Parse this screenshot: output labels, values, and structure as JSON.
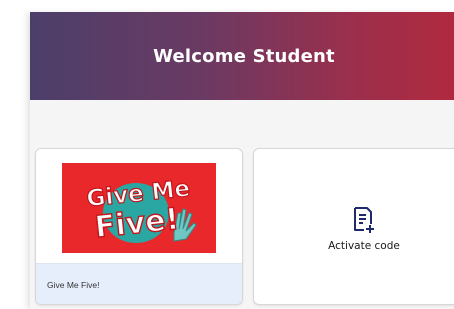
{
  "header": {
    "title": "Welcome Student"
  },
  "books": [
    {
      "title": "Give Me Five!",
      "cover_logo_text": "Give Me Five!",
      "cover_color": "#e8282a"
    }
  ],
  "activate": {
    "label": "Activate code",
    "icon": "document-add-icon"
  },
  "colors": {
    "header_gradient_start": "#4b3f6a",
    "header_gradient_end": "#b02a3f",
    "book_footer_bg": "#e6eefc",
    "icon_color": "#1f2a6b"
  }
}
